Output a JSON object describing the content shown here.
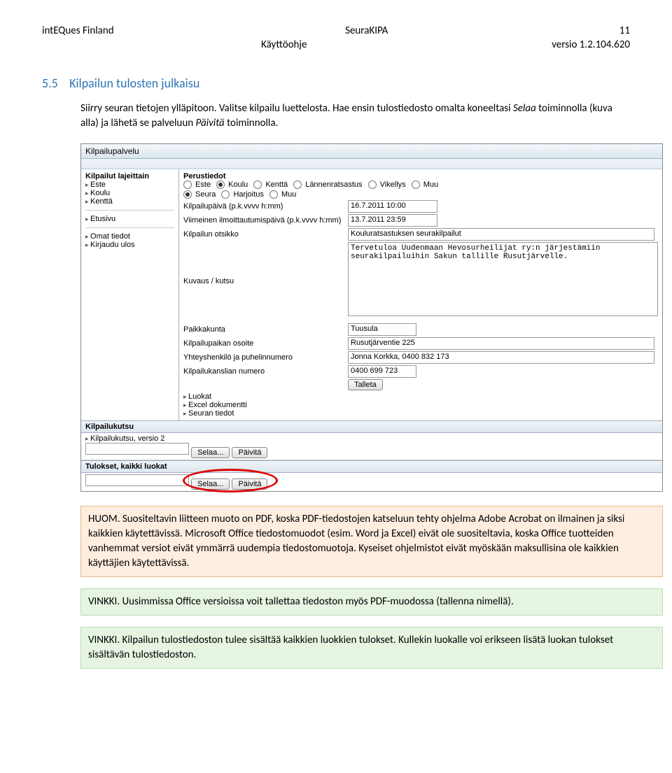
{
  "header": {
    "left": "intEQues Finland",
    "center_top": "SeuraKIPA",
    "center_bottom": "Käyttöohje",
    "right_top": "11",
    "right_bottom": "versio 1.2.104.620"
  },
  "section": {
    "number": "5.5",
    "title": "Kilpailun tulosten julkaisu",
    "p1": "Siirry seuran tietojen ylläpitoon. Valitse kilpailu luettelosta. Hae ensin tulostiedosto omalta koneeltasi ",
    "p1_i1": "Selaa",
    "p1_mid": " toiminnolla (kuva alla) ja lähetä se palveluun ",
    "p1_i2": "Päivitä",
    "p1_end": " toiminnolla."
  },
  "screenshot": {
    "top_title": "Kilpailupalvelu",
    "left_title": "Kilpailut lajeittain",
    "left_items": [
      "Este",
      "Koulu",
      "Kenttä"
    ],
    "left_etusivu": "Etusivu",
    "left_omat": "Omat tiedot",
    "left_logout": "Kirjaudu ulos",
    "r_perustiedot": "Perustiedot",
    "radios1": [
      "Este",
      "Koulu",
      "Kenttä",
      "Lännenratsastus",
      "Vikellys",
      "Muu"
    ],
    "radios1_checked": "Koulu",
    "radios2": [
      "Seura",
      "Harjoitus",
      "Muu"
    ],
    "radios2_checked": "Seura",
    "f_date_label": "Kilpailupäivä (p.k.vvvv h:mm)",
    "f_date_value": "16.7.2011 10:00",
    "f_enddate_label": "Viimeinen ilmoittautumispäivä (p.k.vvvv h:mm)",
    "f_enddate_value": "13.7.2011 23:59",
    "f_title_label": "Kilpailun otsikko",
    "f_title_value": "Kouluratsastuksen seurakilpailut",
    "f_desc_label": "Kuvaus / kutsu",
    "f_desc_value": "Tervetuloa Uudenmaan Hevosurheilijat ry:n järjestämiin seurakilpailuihin Sakun tallille Rusutjärvelle.",
    "f_city_label": "Paikkakunta",
    "f_city_value": "Tuusula",
    "f_addr_label": "Kilpailupaikan osoite",
    "f_addr_value": "Rusutjärventie 225",
    "f_contact_label": "Yhteyshenkilö ja puhelinnumero",
    "f_contact_value": "Jonna Korkka, 0400 832 173",
    "f_office_label": "Kilpailukanslian numero",
    "f_office_value": "0400 699 723",
    "btn_save": "Talleta",
    "sec_items": [
      "Luokat",
      "Excel dokumentti",
      "Seuran tiedot"
    ],
    "sec_kutsu": "Kilpailukutsu",
    "sec_kutsu_sub": "Kilpailukutsu, versio 2",
    "sec_tulokset": "Tulokset, kaikki luokat",
    "btn_browse": "Selaa...",
    "btn_refresh": "Päivitä"
  },
  "note1": {
    "text_pre": "HUOM. Suositeltavin liitteen muoto on PDF, koska PDF-tiedostojen katseluun tehty ohjelma Adobe Acrobat on ilmainen ja siksi kaikkien käytettävissä. Microsoft Office tiedostomuodot (esim. Word ja Excel) eivät ole suositeltavia, koska Office tuotteiden vanhemmat versiot eivät ymmärrä uudempia tiedostomuotoja. Kyseiset ohjelmistot eivät myöskään maksullisina ole kaikkien käyttäjien käytettävissä."
  },
  "note2": {
    "text": "VINKKI. Uusimmissa Office versioissa voit tallettaa tiedoston myös PDF-muodossa (tallenna nimellä)."
  },
  "note3": {
    "text": "VINKKI. Kilpailun tulostiedoston tulee sisältää kaikkien luokkien tulokset. Kullekin luokalle voi erikseen lisätä luokan tulokset sisältävän tulostiedoston."
  }
}
